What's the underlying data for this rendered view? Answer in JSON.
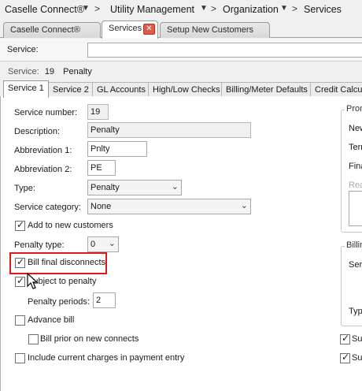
{
  "breadcrumb": {
    "items": [
      "Caselle Connect®",
      "Utility Management",
      "Organization",
      "Services"
    ]
  },
  "tabs": [
    {
      "label": "Caselle Connect®"
    },
    {
      "label": "Services"
    },
    {
      "label": "Setup New Customers"
    }
  ],
  "tab_close_glyph": "✕",
  "search": {
    "label": "Service:",
    "value": ""
  },
  "service_caption": {
    "label": "Service:",
    "number": "19",
    "name": "Penalty"
  },
  "subtabs": [
    "Service 1",
    "Service 2",
    "GL Accounts",
    "High/Low Checks",
    "Billing/Meter Defaults",
    "Credit Calcula"
  ],
  "form": {
    "service_number": {
      "label": "Service number:",
      "value": "19"
    },
    "description": {
      "label": "Description:",
      "value": "Penalty"
    },
    "abbreviation1": {
      "label": "Abbreviation 1:",
      "value": "Pnlty"
    },
    "abbreviation2": {
      "label": "Abbreviation 2:",
      "value": "PE"
    },
    "type": {
      "label": "Type:",
      "value": "Penalty"
    },
    "service_category": {
      "label": "Service category:",
      "value": "None"
    },
    "add_to_new_customers": {
      "label": "Add to new customers",
      "checked": true
    },
    "penalty_type": {
      "label": "Penalty type:",
      "value": "0"
    },
    "bill_final_disconnects": {
      "label": "Bill final disconnects",
      "checked": true
    },
    "subject_to_penalty": {
      "label": "Subject to penalty",
      "checked": true
    },
    "penalty_periods": {
      "label": "Penalty periods:",
      "value": "2"
    },
    "advance_bill": {
      "label": "Advance bill",
      "checked": false
    },
    "bill_prior_on_new_connects": {
      "label": "Bill prior on new connects",
      "checked": false
    },
    "include_current_charges": {
      "label": "Include current charges in payment entry",
      "checked": false
    }
  },
  "right_panel": {
    "group1_title": "Pron",
    "group1_labels": [
      "New",
      "Terr",
      "Fina",
      "Rea"
    ],
    "group2_title": "Billin",
    "group2_labels": [
      "Ser",
      "Typ"
    ],
    "checkbox_labels": [
      "Sul",
      "Sul"
    ]
  },
  "check_glyph": "✓",
  "dropdown_glyph": "⌄"
}
